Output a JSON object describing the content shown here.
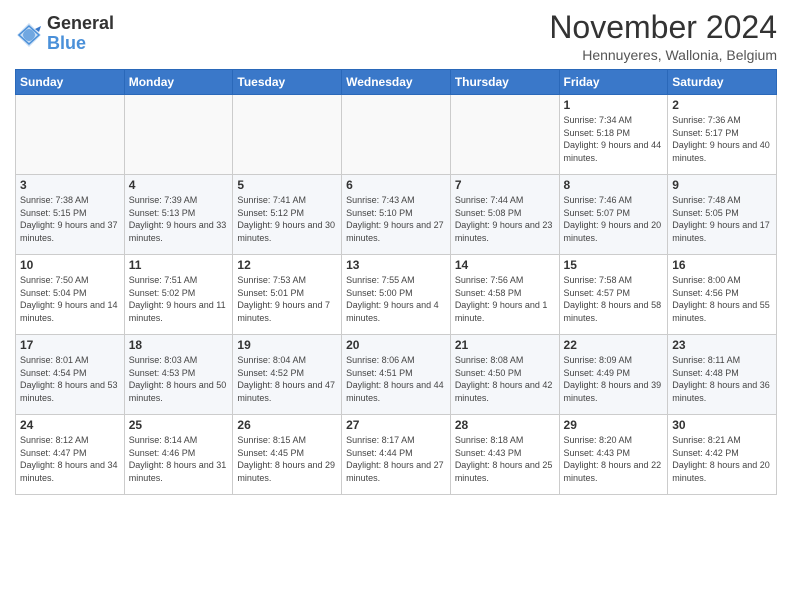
{
  "logo": {
    "line1": "General",
    "line2": "Blue"
  },
  "title": "November 2024",
  "subtitle": "Hennuyeres, Wallonia, Belgium",
  "days_of_week": [
    "Sunday",
    "Monday",
    "Tuesday",
    "Wednesday",
    "Thursday",
    "Friday",
    "Saturday"
  ],
  "weeks": [
    [
      {
        "day": "",
        "info": ""
      },
      {
        "day": "",
        "info": ""
      },
      {
        "day": "",
        "info": ""
      },
      {
        "day": "",
        "info": ""
      },
      {
        "day": "",
        "info": ""
      },
      {
        "day": "1",
        "info": "Sunrise: 7:34 AM\nSunset: 5:18 PM\nDaylight: 9 hours\nand 44 minutes."
      },
      {
        "day": "2",
        "info": "Sunrise: 7:36 AM\nSunset: 5:17 PM\nDaylight: 9 hours\nand 40 minutes."
      }
    ],
    [
      {
        "day": "3",
        "info": "Sunrise: 7:38 AM\nSunset: 5:15 PM\nDaylight: 9 hours\nand 37 minutes."
      },
      {
        "day": "4",
        "info": "Sunrise: 7:39 AM\nSunset: 5:13 PM\nDaylight: 9 hours\nand 33 minutes."
      },
      {
        "day": "5",
        "info": "Sunrise: 7:41 AM\nSunset: 5:12 PM\nDaylight: 9 hours\nand 30 minutes."
      },
      {
        "day": "6",
        "info": "Sunrise: 7:43 AM\nSunset: 5:10 PM\nDaylight: 9 hours\nand 27 minutes."
      },
      {
        "day": "7",
        "info": "Sunrise: 7:44 AM\nSunset: 5:08 PM\nDaylight: 9 hours\nand 23 minutes."
      },
      {
        "day": "8",
        "info": "Sunrise: 7:46 AM\nSunset: 5:07 PM\nDaylight: 9 hours\nand 20 minutes."
      },
      {
        "day": "9",
        "info": "Sunrise: 7:48 AM\nSunset: 5:05 PM\nDaylight: 9 hours\nand 17 minutes."
      }
    ],
    [
      {
        "day": "10",
        "info": "Sunrise: 7:50 AM\nSunset: 5:04 PM\nDaylight: 9 hours\nand 14 minutes."
      },
      {
        "day": "11",
        "info": "Sunrise: 7:51 AM\nSunset: 5:02 PM\nDaylight: 9 hours\nand 11 minutes."
      },
      {
        "day": "12",
        "info": "Sunrise: 7:53 AM\nSunset: 5:01 PM\nDaylight: 9 hours\nand 7 minutes."
      },
      {
        "day": "13",
        "info": "Sunrise: 7:55 AM\nSunset: 5:00 PM\nDaylight: 9 hours\nand 4 minutes."
      },
      {
        "day": "14",
        "info": "Sunrise: 7:56 AM\nSunset: 4:58 PM\nDaylight: 9 hours\nand 1 minute."
      },
      {
        "day": "15",
        "info": "Sunrise: 7:58 AM\nSunset: 4:57 PM\nDaylight: 8 hours\nand 58 minutes."
      },
      {
        "day": "16",
        "info": "Sunrise: 8:00 AM\nSunset: 4:56 PM\nDaylight: 8 hours\nand 55 minutes."
      }
    ],
    [
      {
        "day": "17",
        "info": "Sunrise: 8:01 AM\nSunset: 4:54 PM\nDaylight: 8 hours\nand 53 minutes."
      },
      {
        "day": "18",
        "info": "Sunrise: 8:03 AM\nSunset: 4:53 PM\nDaylight: 8 hours\nand 50 minutes."
      },
      {
        "day": "19",
        "info": "Sunrise: 8:04 AM\nSunset: 4:52 PM\nDaylight: 8 hours\nand 47 minutes."
      },
      {
        "day": "20",
        "info": "Sunrise: 8:06 AM\nSunset: 4:51 PM\nDaylight: 8 hours\nand 44 minutes."
      },
      {
        "day": "21",
        "info": "Sunrise: 8:08 AM\nSunset: 4:50 PM\nDaylight: 8 hours\nand 42 minutes."
      },
      {
        "day": "22",
        "info": "Sunrise: 8:09 AM\nSunset: 4:49 PM\nDaylight: 8 hours\nand 39 minutes."
      },
      {
        "day": "23",
        "info": "Sunrise: 8:11 AM\nSunset: 4:48 PM\nDaylight: 8 hours\nand 36 minutes."
      }
    ],
    [
      {
        "day": "24",
        "info": "Sunrise: 8:12 AM\nSunset: 4:47 PM\nDaylight: 8 hours\nand 34 minutes."
      },
      {
        "day": "25",
        "info": "Sunrise: 8:14 AM\nSunset: 4:46 PM\nDaylight: 8 hours\nand 31 minutes."
      },
      {
        "day": "26",
        "info": "Sunrise: 8:15 AM\nSunset: 4:45 PM\nDaylight: 8 hours\nand 29 minutes."
      },
      {
        "day": "27",
        "info": "Sunrise: 8:17 AM\nSunset: 4:44 PM\nDaylight: 8 hours\nand 27 minutes."
      },
      {
        "day": "28",
        "info": "Sunrise: 8:18 AM\nSunset: 4:43 PM\nDaylight: 8 hours\nand 25 minutes."
      },
      {
        "day": "29",
        "info": "Sunrise: 8:20 AM\nSunset: 4:43 PM\nDaylight: 8 hours\nand 22 minutes."
      },
      {
        "day": "30",
        "info": "Sunrise: 8:21 AM\nSunset: 4:42 PM\nDaylight: 8 hours\nand 20 minutes."
      }
    ]
  ]
}
